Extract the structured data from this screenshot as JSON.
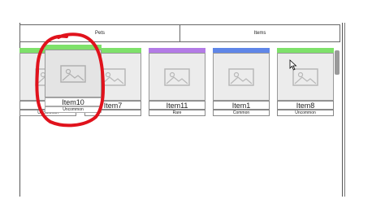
{
  "tabs": {
    "pets": "Pets",
    "items": "Items"
  },
  "colors": {
    "uncommon": "#7ee16a",
    "rare": "#b37be6",
    "common": "#5f86e8",
    "annotation": "#e0121c"
  },
  "items": [
    {
      "name": "It",
      "rarity": "Uncommon",
      "bar": "uncommon"
    },
    {
      "name": "Item7",
      "rarity": "",
      "bar": "uncommon"
    },
    {
      "name": "Item11",
      "rarity": "Rare",
      "bar": "rare"
    },
    {
      "name": "Item1",
      "rarity": "Common",
      "bar": "common"
    },
    {
      "name": "Item8",
      "rarity": "Uncommon",
      "bar": "uncommon"
    }
  ],
  "dragged_item": {
    "name": "Item10",
    "rarity": "Uncommon",
    "bar": "uncommon"
  },
  "icons": {
    "image": "image-placeholder-icon",
    "cursor": "mouse-pointer-icon"
  }
}
